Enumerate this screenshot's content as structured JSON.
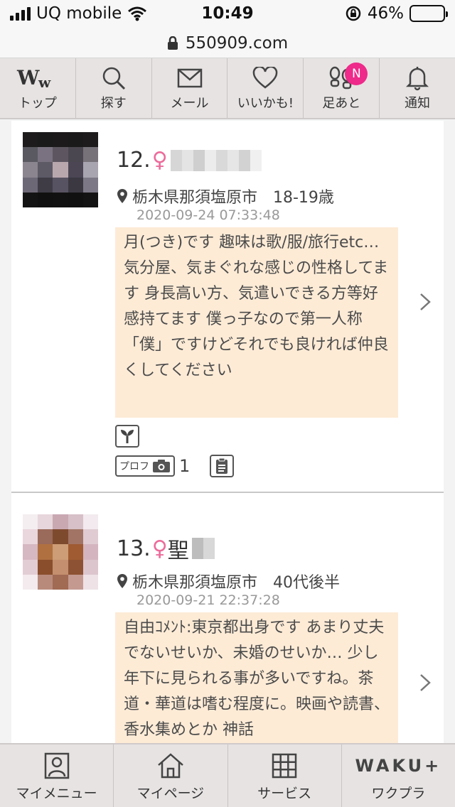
{
  "status_bar": {
    "carrier": "UQ mobile",
    "time": "10:49",
    "battery": "46%",
    "battery_level": 0.46
  },
  "browser": {
    "url": "550909.com"
  },
  "top_nav": {
    "items": [
      {
        "label": "トップ",
        "icon": "ww-logo-icon"
      },
      {
        "label": "探す",
        "icon": "search-icon"
      },
      {
        "label": "メール",
        "icon": "mail-icon"
      },
      {
        "label": "いいかも!",
        "icon": "heart-icon"
      },
      {
        "label": "足あと",
        "icon": "footprints-icon",
        "badge": "N"
      },
      {
        "label": "通知",
        "icon": "bell-icon"
      }
    ]
  },
  "profiles": [
    {
      "number": "12.",
      "gender_symbol": "♀",
      "name_visible": "",
      "location_age": "栃木県那須塩原市　18-19歳",
      "date": "2020-09-24 07:33:48",
      "comment": "月(つき)です 趣味は歌/服/旅行etc… 気分屋、気まぐれな感じの性格してます 身長高い方、気遣いできる方等好感持てます 僕っ子なので第一人称「僕」ですけどそれでも良ければ仲良くしてください",
      "prof_tag": "プロフ",
      "photo_count": "1"
    },
    {
      "number": "13.",
      "gender_symbol": "♀",
      "name_visible": "聖",
      "location_age": "栃木県那須塩原市　40代後半",
      "date": "2020-09-21 22:37:28",
      "comment": "自由ｺﾒﾝﾄ:東京都出身です あまり丈夫でないせいか、未婚のせいか… 少し年下に見られる事が多いですね。茶道・華道は嗜む程度に。映画や読書、香水集めとか 神話"
    }
  ],
  "bottom_nav": {
    "items": [
      {
        "label": "マイメニュー",
        "icon": "person-icon"
      },
      {
        "label": "マイページ",
        "icon": "home-icon"
      },
      {
        "label": "サービス",
        "icon": "grid-icon"
      },
      {
        "label": "ワクプラ",
        "icon": "waku-logo",
        "logo_text": "WAKU+"
      }
    ]
  }
}
